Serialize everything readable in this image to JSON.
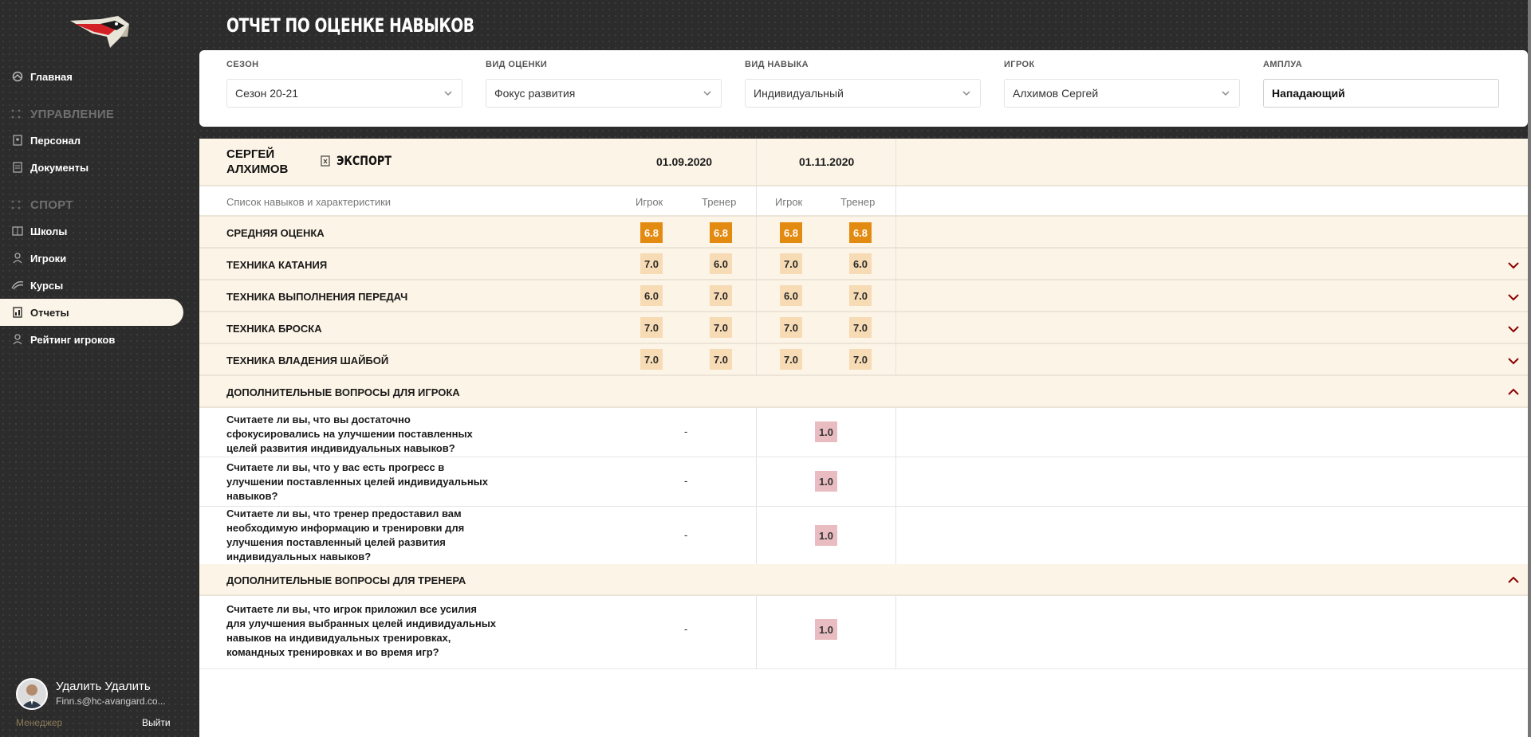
{
  "page": {
    "title": "ОТЧЕТ ПО ОЦЕНКЕ НАВЫКОВ"
  },
  "colors": {
    "accent": "#e38a11",
    "badge": "#f6dbb4",
    "pink_badge": "#e8bcc0",
    "beige_row": "#fcf4e6",
    "chevron": "#8b0000"
  },
  "sidebar": {
    "items": [
      {
        "label": "Главная",
        "icon": "home-icon"
      },
      {
        "label": "Персонал",
        "icon": "staff-icon"
      },
      {
        "label": "Документы",
        "icon": "document-icon"
      },
      {
        "label": "Школы",
        "icon": "school-icon"
      },
      {
        "label": "Игроки",
        "icon": "player-icon"
      },
      {
        "label": "Курсы",
        "icon": "courses-icon"
      },
      {
        "label": "Отчеты",
        "icon": "reports-icon",
        "active": true
      },
      {
        "label": "Рейтинг игроков",
        "icon": "rating-icon"
      }
    ],
    "sections": {
      "management": "УПРАВЛЕНИЕ",
      "sport": "СПОРТ"
    }
  },
  "user": {
    "name": "Удалить Удалить",
    "email": "Finn.s@hc-avangard.co...",
    "role": "Менеджер",
    "logout": "Выйти"
  },
  "filters": [
    {
      "label": "СЕЗОН",
      "value": "Сезон 20-21"
    },
    {
      "label": "ВИД ОЦЕНКИ",
      "value": "Фокус развития"
    },
    {
      "label": "ВИД НАВЫКА",
      "value": "Индивидуальный"
    },
    {
      "label": "ИГРОК",
      "value": "Алхимов Сергей"
    },
    {
      "label": "АМПЛУА",
      "value": "Нападающий"
    }
  ],
  "report": {
    "player_first": "СЕРГЕЙ",
    "player_last": "АЛХИМОВ",
    "export_label": "ЭКСПОРТ",
    "dates": [
      "01.09.2020",
      "01.11.2020"
    ],
    "list_header": "Список навыков и характеристики",
    "col_player": "Игрок",
    "col_coach": "Тренер",
    "average": {
      "label": "СРЕДНЯЯ ОЦЕНКА",
      "values": [
        "6.8",
        "6.8",
        "6.8",
        "6.8"
      ]
    },
    "skills": [
      {
        "label": "ТЕХНИКА КАТАНИЯ",
        "values": [
          "7.0",
          "6.0",
          "7.0",
          "6.0"
        ]
      },
      {
        "label": "ТЕХНИКА ВЫПОЛНЕНИЯ ПЕРЕДАЧ",
        "values": [
          "6.0",
          "7.0",
          "6.0",
          "7.0"
        ]
      },
      {
        "label": "ТЕХНИКА БРОСКА",
        "values": [
          "7.0",
          "7.0",
          "7.0",
          "7.0"
        ]
      },
      {
        "label": "ТЕХНИКА ВЛАДЕНИЯ ШАЙБОЙ",
        "values": [
          "7.0",
          "7.0",
          "7.0",
          "7.0"
        ]
      }
    ],
    "player_questions_title": "ДОПОЛНИТЕЛЬНЫЕ ВОПРОСЫ ДЛЯ ИГРОКА",
    "player_questions": [
      {
        "text": "Считаете ли вы, что вы достаточно сфокусировались на улучшении поставленных целей развития индивидуальных навыков?",
        "first": "-",
        "second": "1.0"
      },
      {
        "text": "Считаете ли вы, что у вас есть прогресс в улучшении поставленных целей индивидуальных навыков?",
        "first": "-",
        "second": "1.0"
      },
      {
        "text": "Считаете ли вы, что тренер предоставил вам необходимую информацию и тренировки для улучшения поставленный целей развития индивидуальных навыков?",
        "first": "-",
        "second": "1.0"
      }
    ],
    "coach_questions_title": "ДОПОЛНИТЕЛЬНЫЕ ВОПРОСЫ ДЛЯ ТРЕНЕРА",
    "coach_questions": [
      {
        "text": "Считаете ли вы, что игрок приложил все усилия для улучшения выбранных целей индивидуальных навыков на индивидуальных тренировках, командных тренировках и во время игр?",
        "first": "-",
        "second": "1.0"
      }
    ]
  }
}
